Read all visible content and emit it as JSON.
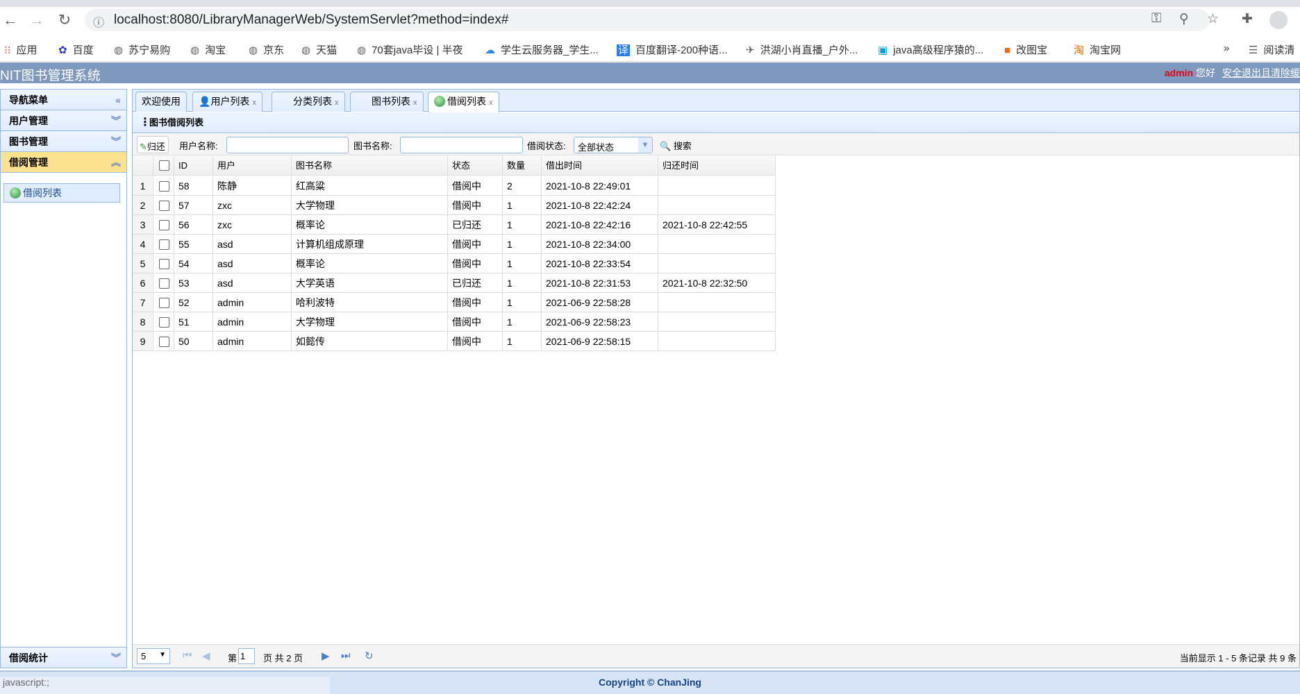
{
  "browser": {
    "url": "localhost:8080/LibraryManagerWeb/SystemServlet?method=index#",
    "bookmarks": [
      "应用",
      "百度",
      "苏宁易购",
      "淘宝",
      "京东",
      "天猫",
      "70套java毕设 | 半夜",
      "学生云服务器_学生...",
      "百度翻译-200种语...",
      "洪湖小肖直播_户外...",
      "java高级程序猿的...",
      "改图宝",
      "淘宝网"
    ],
    "more": "»",
    "reading_list": "阅读清",
    "status_text": "javascript:;"
  },
  "app": {
    "title": "NIT图书管理系统",
    "user": "admin",
    "greeting": "您好",
    "logout": "安全退出且清除缓"
  },
  "sidebar": {
    "title": "导航菜单",
    "sections": [
      "用户管理",
      "图书管理",
      "借阅管理"
    ],
    "active_item": "借阅列表",
    "bottom_section": "借阅统计"
  },
  "tabs": [
    {
      "label": "欢迎使用"
    },
    {
      "label": "用户列表",
      "close": "x"
    },
    {
      "label": "分类列表",
      "close": "x"
    },
    {
      "label": "图书列表",
      "close": "x"
    },
    {
      "label": "借阅列表",
      "close": "x"
    }
  ],
  "panel": {
    "title": "图书借阅列表"
  },
  "toolbar": {
    "return_label": "归还",
    "user_label": "用户名称:",
    "user_value": "",
    "book_label": "图书名称:",
    "book_value": "",
    "status_label": "借阅状态:",
    "status_value": "全部状态",
    "search_label": "搜索"
  },
  "table": {
    "columns": [
      "ID",
      "用户",
      "图书名称",
      "状态",
      "数量",
      "借出时间",
      "归还时间"
    ],
    "rows": [
      [
        "58",
        "陈静",
        "红高粱",
        "借阅中",
        "2",
        "2021-10-8 22:49:01",
        ""
      ],
      [
        "57",
        "zxc",
        "大学物理",
        "借阅中",
        "1",
        "2021-10-8 22:42:24",
        ""
      ],
      [
        "56",
        "zxc",
        "概率论",
        "已归还",
        "1",
        "2021-10-8 22:42:16",
        "2021-10-8 22:42:55"
      ],
      [
        "55",
        "asd",
        "计算机组成原理",
        "借阅中",
        "1",
        "2021-10-8 22:34:00",
        ""
      ],
      [
        "54",
        "asd",
        "概率论",
        "借阅中",
        "1",
        "2021-10-8 22:33:54",
        ""
      ],
      [
        "53",
        "asd",
        "大学英语",
        "已归还",
        "1",
        "2021-10-8 22:31:53",
        "2021-10-8 22:32:50"
      ],
      [
        "52",
        "admin",
        "哈利波特",
        "借阅中",
        "1",
        "2021-06-9 22:58:28",
        ""
      ],
      [
        "51",
        "admin",
        "大学物理",
        "借阅中",
        "1",
        "2021-06-9 22:58:23",
        ""
      ],
      [
        "50",
        "admin",
        "如懿传",
        "借阅中",
        "1",
        "2021-06-9 22:58:15",
        ""
      ]
    ]
  },
  "pager": {
    "page_size": "5",
    "page_prefix": "第",
    "page_value": "1",
    "page_suffix": "页 共 2 页",
    "summary": "当前显示 1 - 5 条记录 共 9 条"
  },
  "footer": {
    "copyright": "Copyright © ChanJing"
  }
}
